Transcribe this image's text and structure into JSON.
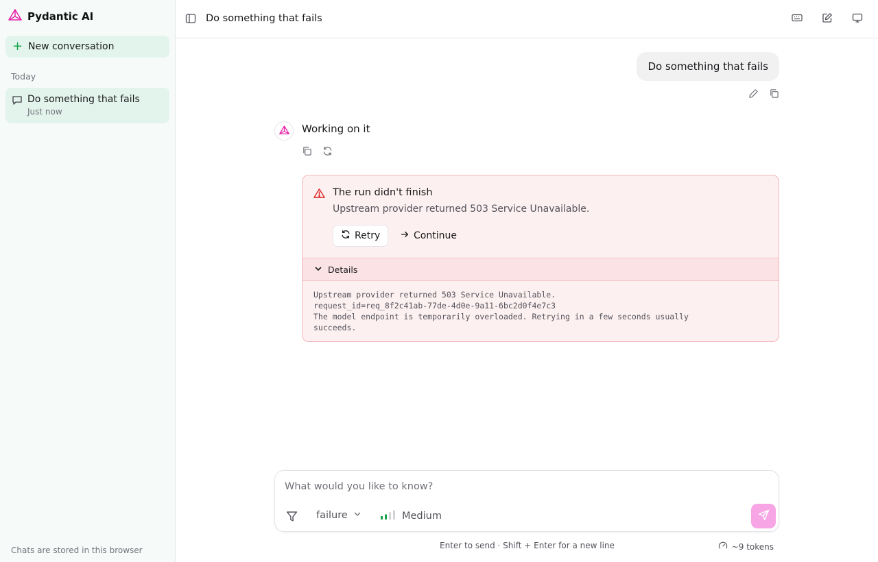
{
  "app": {
    "title": "Pydantic AI",
    "logo_icon": "pydantic-logo-icon",
    "accent": "#e520a8"
  },
  "sidebar": {
    "new_conversation_label": "New conversation",
    "section_label": "Today",
    "conversations": [
      {
        "title": "Do something that fails",
        "subtitle": "Just now"
      }
    ],
    "footer": "Chats are stored in this browser"
  },
  "header": {
    "title": "Do something that fails",
    "icons": [
      "sidebar-toggle-icon",
      "keyboard-icon",
      "edit-icon",
      "monitor-icon"
    ]
  },
  "messages": {
    "user": {
      "text": "Do something that fails",
      "actions": [
        "pencil-icon",
        "copy-icon"
      ]
    },
    "assistant": {
      "text": "Working on it",
      "actions": [
        "copy-icon",
        "refresh-icon"
      ]
    }
  },
  "error": {
    "title": "The run didn't finish",
    "message": "Upstream provider returned 503 Service Unavailable.",
    "retry_label": "Retry",
    "continue_label": "Continue",
    "details_label": "Details",
    "details_text": "Upstream provider returned 503 Service Unavailable.\nrequest_id=req_8f2c41ab-77de-4d0e-9a11-6bc2d0f4e7c3\nThe model endpoint is temporarily overloaded. Retrying in a few seconds usually\nsucceeds."
  },
  "composer": {
    "placeholder": "What would you like to know?",
    "model_value": "failure",
    "effort_value": "Medium",
    "effort_level": 2,
    "effort_max": 4,
    "send_color": "#f8a5e5"
  },
  "footer": {
    "hint": "Enter to send · Shift + Enter for a new line",
    "tokens": "~9 tokens"
  }
}
